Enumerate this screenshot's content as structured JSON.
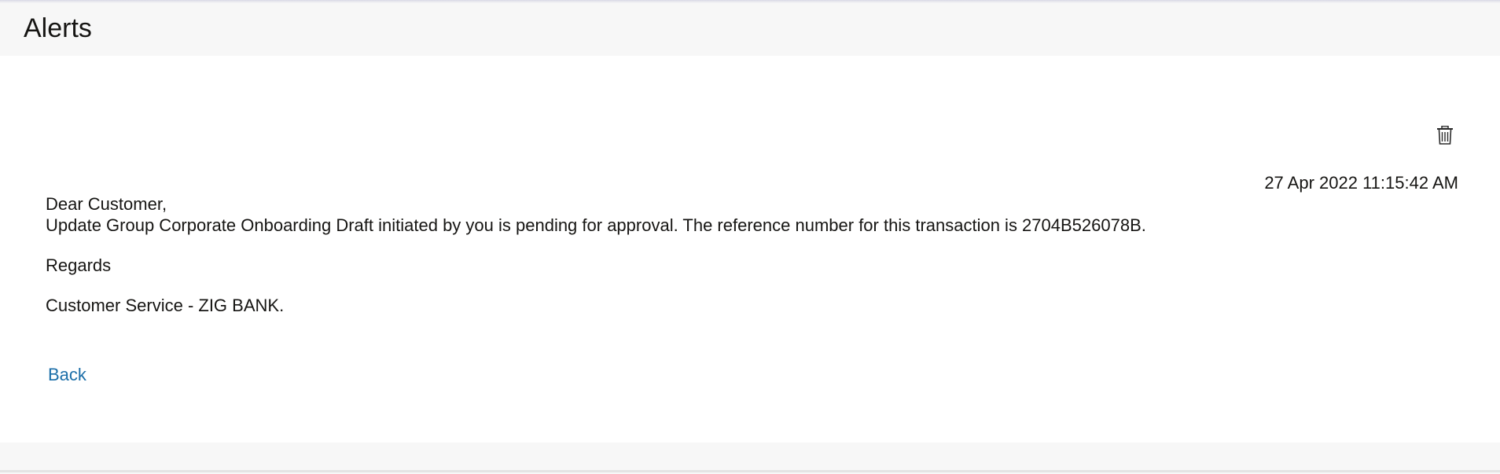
{
  "header": {
    "title": "Alerts"
  },
  "alert": {
    "delete_icon": "trash-icon",
    "timestamp": "27 Apr 2022 11:15:42 AM",
    "greeting": "Dear Customer,",
    "body": "Update Group Corporate Onboarding Draft initiated by you is pending for approval. The reference number for this transaction is 2704B526078B.",
    "regards": "Regards",
    "signature": "Customer Service - ZIG BANK."
  },
  "actions": {
    "back_label": "Back"
  }
}
